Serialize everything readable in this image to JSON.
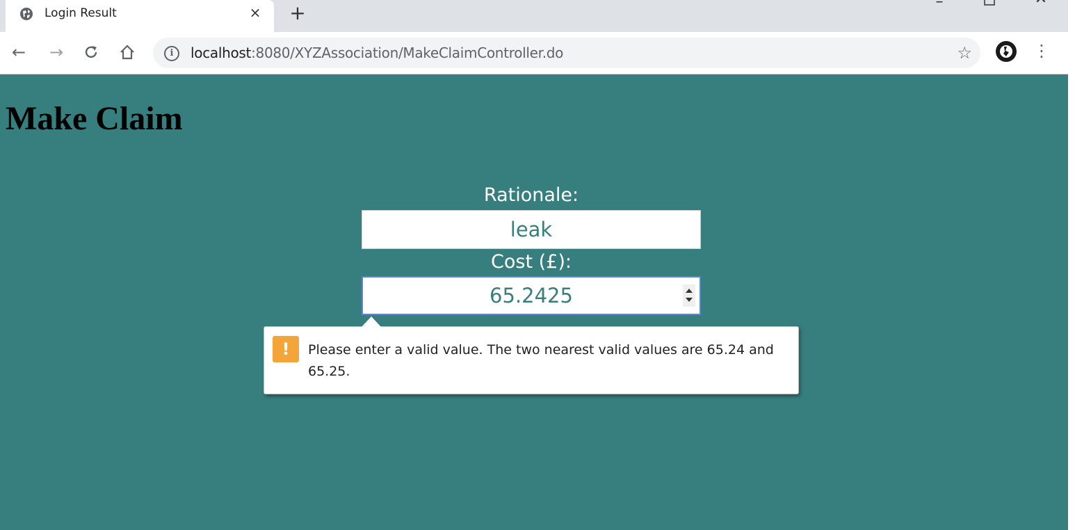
{
  "browser": {
    "tab_title": "Login Result",
    "tab_close": "×",
    "new_tab": "+",
    "url_host": "localhost",
    "url_rest": ":8080/XYZAssociation/MakeClaimController.do",
    "star": "☆",
    "menu": "⋮"
  },
  "page": {
    "title": "Make Claim",
    "rationale_label": "Rationale:",
    "rationale_value": "leak",
    "cost_label": "Cost (£):",
    "cost_value": "65.2425",
    "validation_message": "Please enter a valid value. The two nearest valid values are 65.24 and 65.25."
  },
  "colors": {
    "page_background": "#377e7f",
    "field_text": "#377e7f",
    "warning_icon": "#f4a539",
    "focus_border": "#5b86d7"
  }
}
